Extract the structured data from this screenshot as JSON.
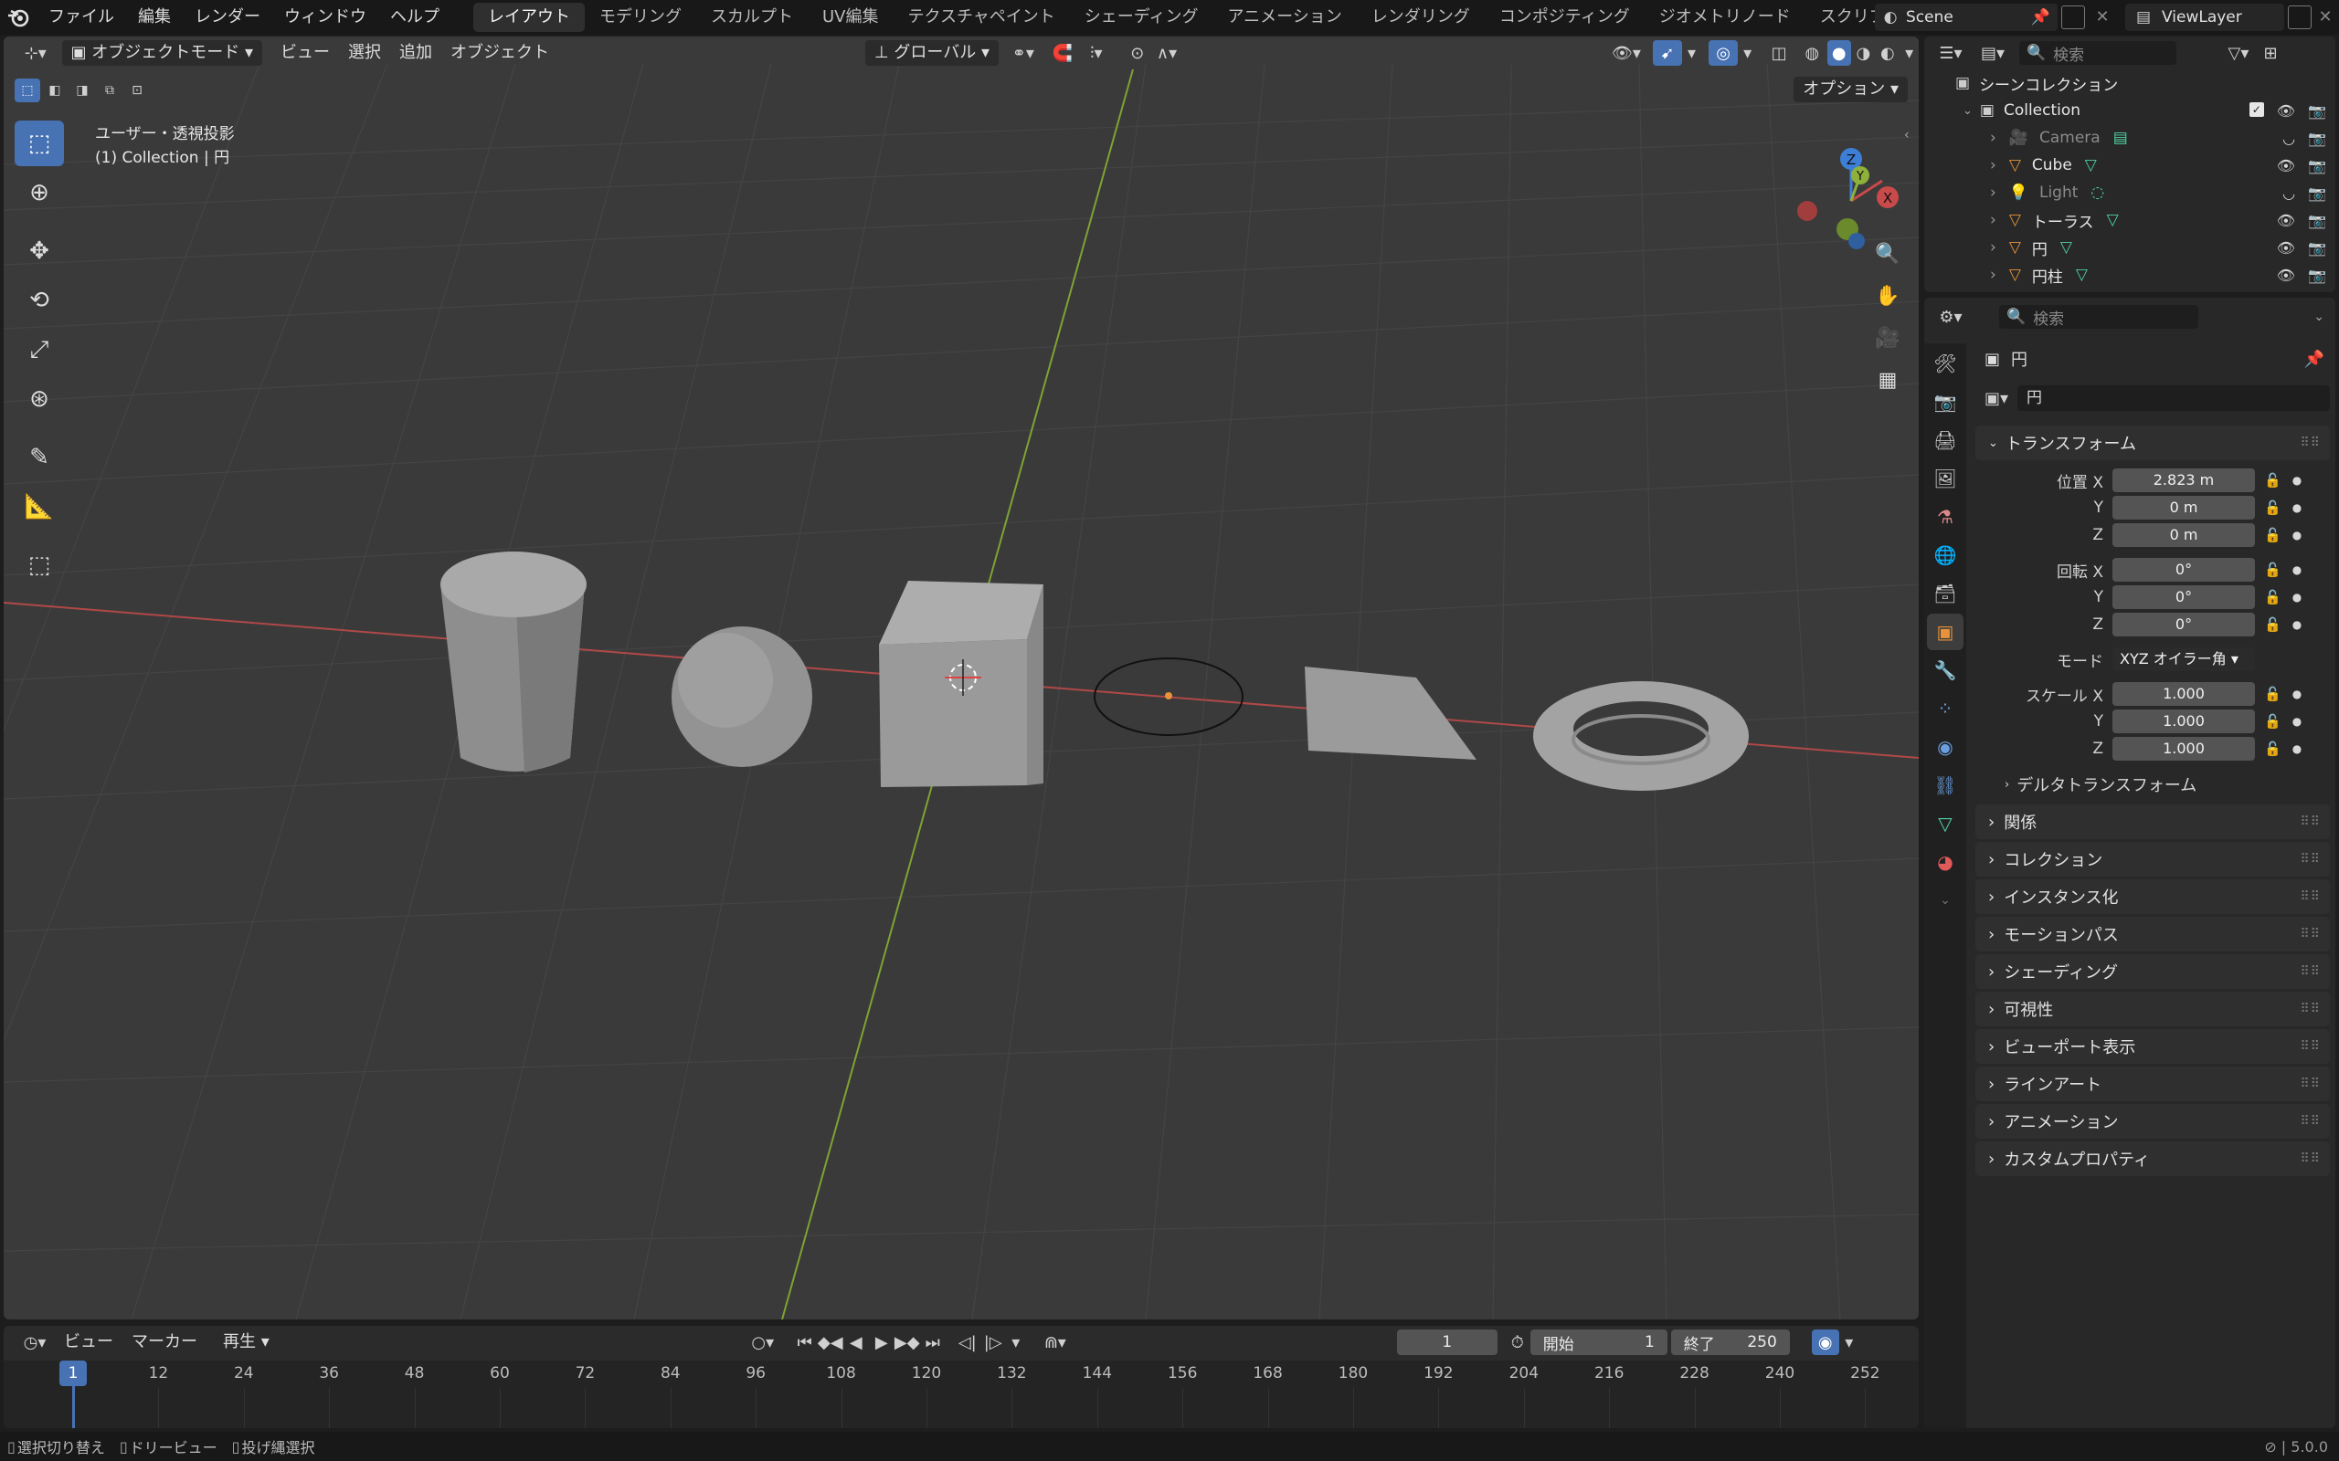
{
  "menu": [
    "ファイル",
    "編集",
    "レンダー",
    "ウィンドウ",
    "ヘルプ"
  ],
  "workspaces": [
    "レイアウト",
    "モデリング",
    "スカルプト",
    "UV編集",
    "テクスチャペイント",
    "シェーディング",
    "アニメーション",
    "レンダリング",
    "コンポジティング",
    "ジオメトリノード",
    "スクリプト作成"
  ],
  "scene": "Scene",
  "view_layer": "ViewLayer",
  "viewport": {
    "mode": "オブジェクトモード",
    "menus": [
      "ビュー",
      "選択",
      "追加",
      "オブジェクト"
    ],
    "orientation": "グローバル",
    "options": "オプション",
    "overlay_title": "ユーザー・透視投影",
    "overlay_sub": "(1) Collection | 円",
    "gizmo_z": "Z",
    "gizmo_y": "Y",
    "gizmo_x": "X"
  },
  "outliner": {
    "search_placeholder": "検索",
    "scene_collection": "シーンコレクション",
    "collection": "Collection",
    "items": [
      {
        "name": "Camera",
        "type": "camera",
        "visible": false
      },
      {
        "name": "Cube",
        "type": "mesh",
        "visible": true
      },
      {
        "name": "Light",
        "type": "light",
        "visible": false
      },
      {
        "name": "トーラス",
        "type": "mesh",
        "visible": true
      },
      {
        "name": "円",
        "type": "mesh",
        "visible": true
      },
      {
        "name": "円柱",
        "type": "mesh",
        "visible": true
      }
    ]
  },
  "properties": {
    "search_placeholder": "検索",
    "object_title": "円",
    "object_name": "円",
    "transform_label": "トランスフォーム",
    "location_label": "位置 X",
    "rotation_label": "回転 X",
    "scale_label": "スケール X",
    "axis_y": "Y",
    "axis_z": "Z",
    "location": [
      "2.823 m",
      "0 m",
      "0 m"
    ],
    "rotation": [
      "0°",
      "0°",
      "0°"
    ],
    "mode_label": "モード",
    "mode_value": "XYZ オイラー角",
    "scale": [
      "1.000",
      "1.000",
      "1.000"
    ],
    "delta_label": "デルタトランスフォーム",
    "panels": [
      "関係",
      "コレクション",
      "インスタンス化",
      "モーションパス",
      "シェーディング",
      "可視性",
      "ビューポート表示",
      "ラインアート",
      "アニメーション",
      "カスタムプロパティ"
    ]
  },
  "timeline": {
    "menus": [
      "ビュー",
      "マーカー"
    ],
    "playback": "再生",
    "current_frame": "1",
    "start_label": "開始",
    "start": "1",
    "end_label": "終了",
    "end": "250",
    "ticks": [
      "1",
      "12",
      "24",
      "36",
      "48",
      "60",
      "72",
      "84",
      "96",
      "108",
      "120",
      "132",
      "144",
      "156",
      "168",
      "180",
      "192",
      "204",
      "216",
      "228",
      "240",
      "252"
    ]
  },
  "status": {
    "items": [
      "選択切り替え",
      "ドリービュー",
      "投げ縄選択"
    ],
    "version": "5.0.0"
  },
  "colors": {
    "accent": "#4772b3",
    "x_axis": "#c84a4a",
    "y_axis": "#8fb03a",
    "z_axis": "#3d7fd6",
    "object_orange": "#e8933a"
  }
}
